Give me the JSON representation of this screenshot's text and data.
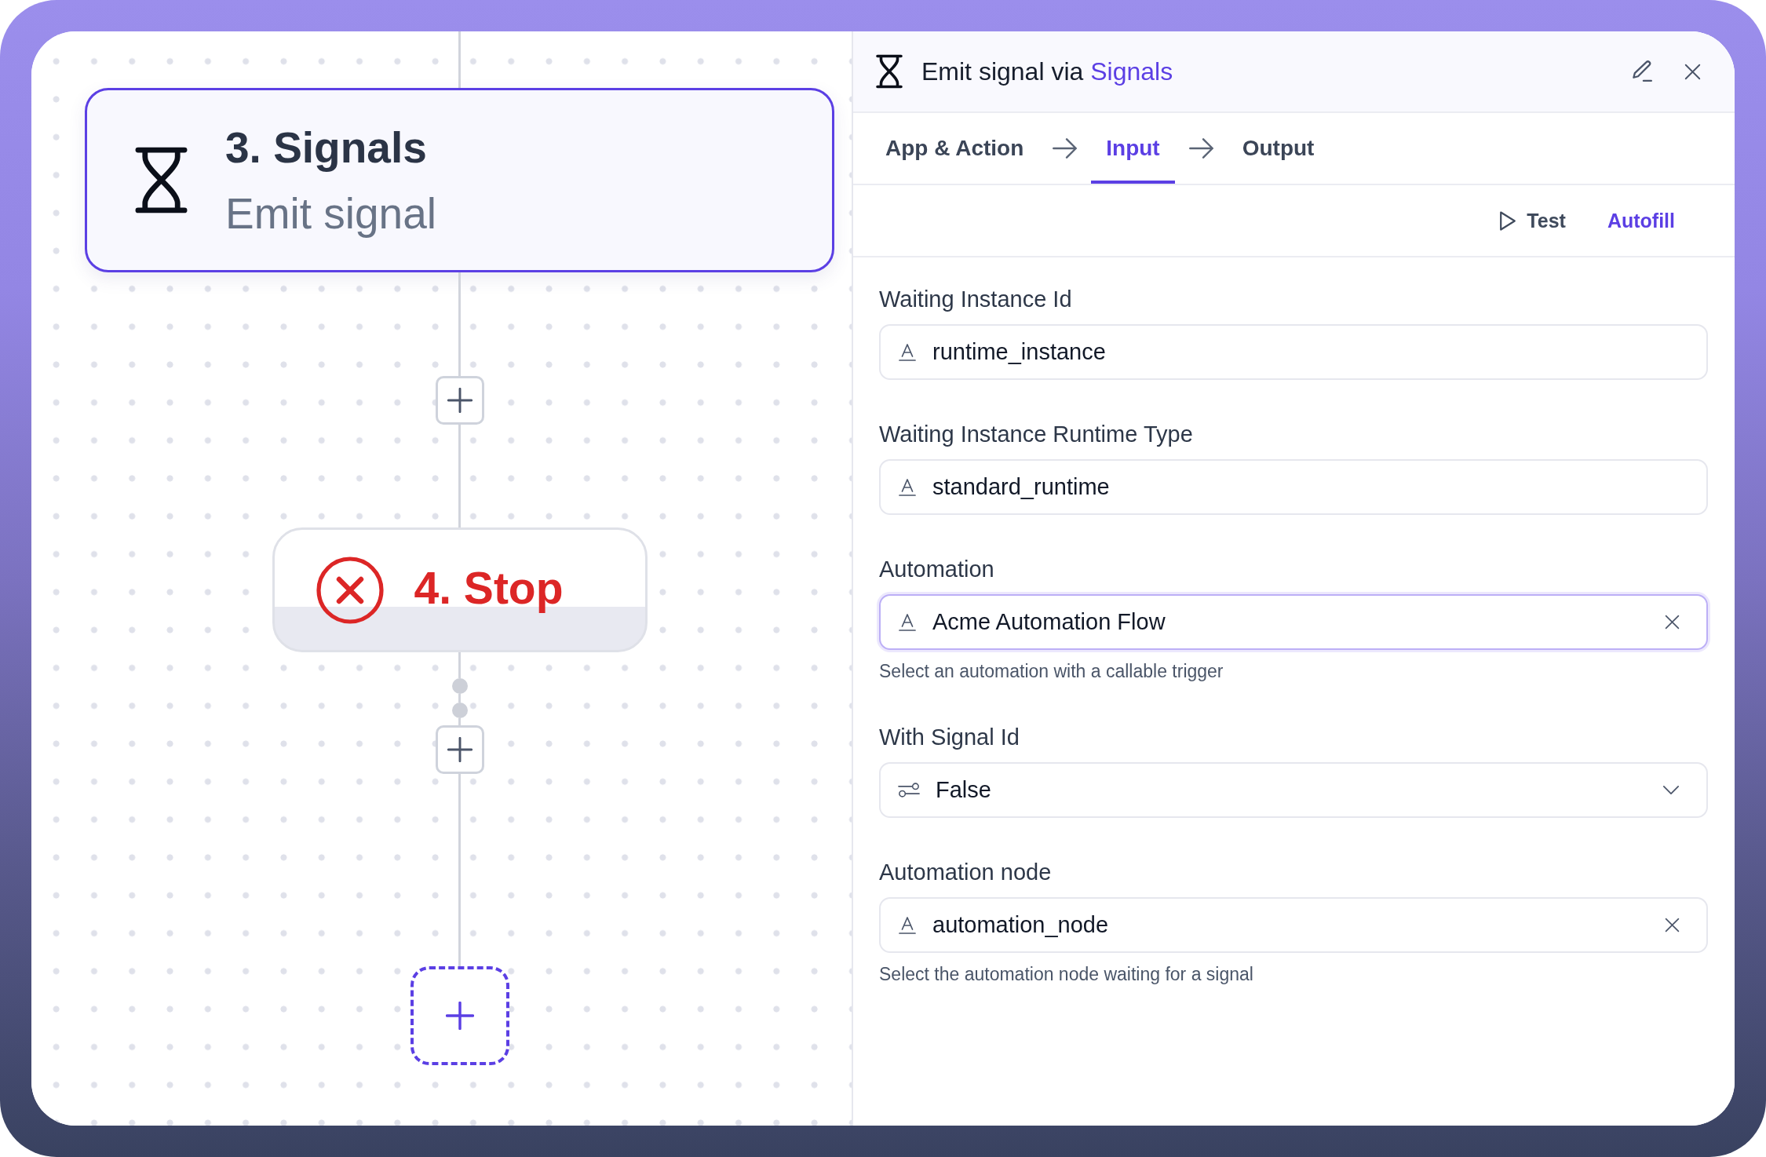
{
  "canvas": {
    "flow": [
      {
        "kind": "step",
        "title": "3. Signals",
        "subtitle": "Emit signal",
        "selected": true
      },
      {
        "kind": "add"
      },
      {
        "kind": "stop",
        "title": "4. Stop",
        "selected": false
      },
      {
        "kind": "junction"
      },
      {
        "kind": "junction"
      },
      {
        "kind": "add"
      },
      {
        "kind": "new-step"
      }
    ]
  },
  "panel": {
    "title": "Emit signal via",
    "app": "Signals",
    "tabs": [
      {
        "label": "App & Action",
        "selected": false
      },
      {
        "label": "Input",
        "selected": true
      },
      {
        "label": "Output",
        "selected": false
      }
    ],
    "toolbar": [
      {
        "kind": "test",
        "label": "Test"
      },
      {
        "kind": "autofill",
        "label": "Autofill"
      }
    ],
    "fields": [
      {
        "label": "Waiting Instance Id",
        "kind": "text",
        "value": "runtime_instance",
        "focused": false,
        "clearable": false
      },
      {
        "label": "Waiting Instance Runtime Type",
        "kind": "text",
        "value": "standard_runtime",
        "focused": false,
        "clearable": false
      },
      {
        "label": "Automation",
        "kind": "text",
        "value": "Acme Automation Flow",
        "focused": true,
        "clearable": true,
        "help": "Select an automation with a callable trigger"
      },
      {
        "label": "With Signal Id",
        "kind": "select",
        "value": "False",
        "focused": false
      },
      {
        "label": "Automation node",
        "kind": "text",
        "value": "automation_node",
        "focused": false,
        "clearable": true,
        "help": "Select the automation node waiting for a signal"
      }
    ]
  }
}
